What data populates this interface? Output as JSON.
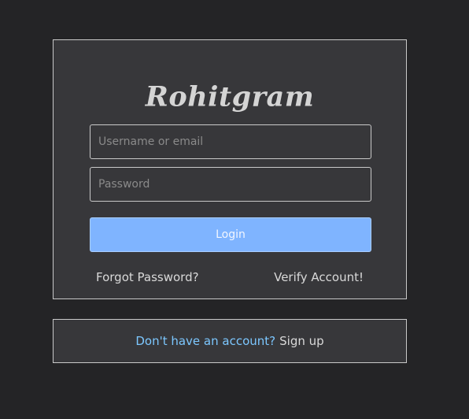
{
  "brand": {
    "name": "Rohitgram"
  },
  "login_form": {
    "username_placeholder": "Username or email",
    "username_value": "",
    "password_placeholder": "Password",
    "password_value": "",
    "login_label": "Login",
    "forgot_password_label": "Forgot Password?",
    "verify_account_label": "Verify Account!"
  },
  "signup": {
    "prompt": "Don't have an account?",
    "link_label": "Sign up"
  },
  "colors": {
    "background": "#242426",
    "card": "#37373a",
    "border": "#c9c9c9",
    "button": "#7fb4ff",
    "prompt_text": "#7cc7ff",
    "link_text": "#d9d9d9"
  }
}
